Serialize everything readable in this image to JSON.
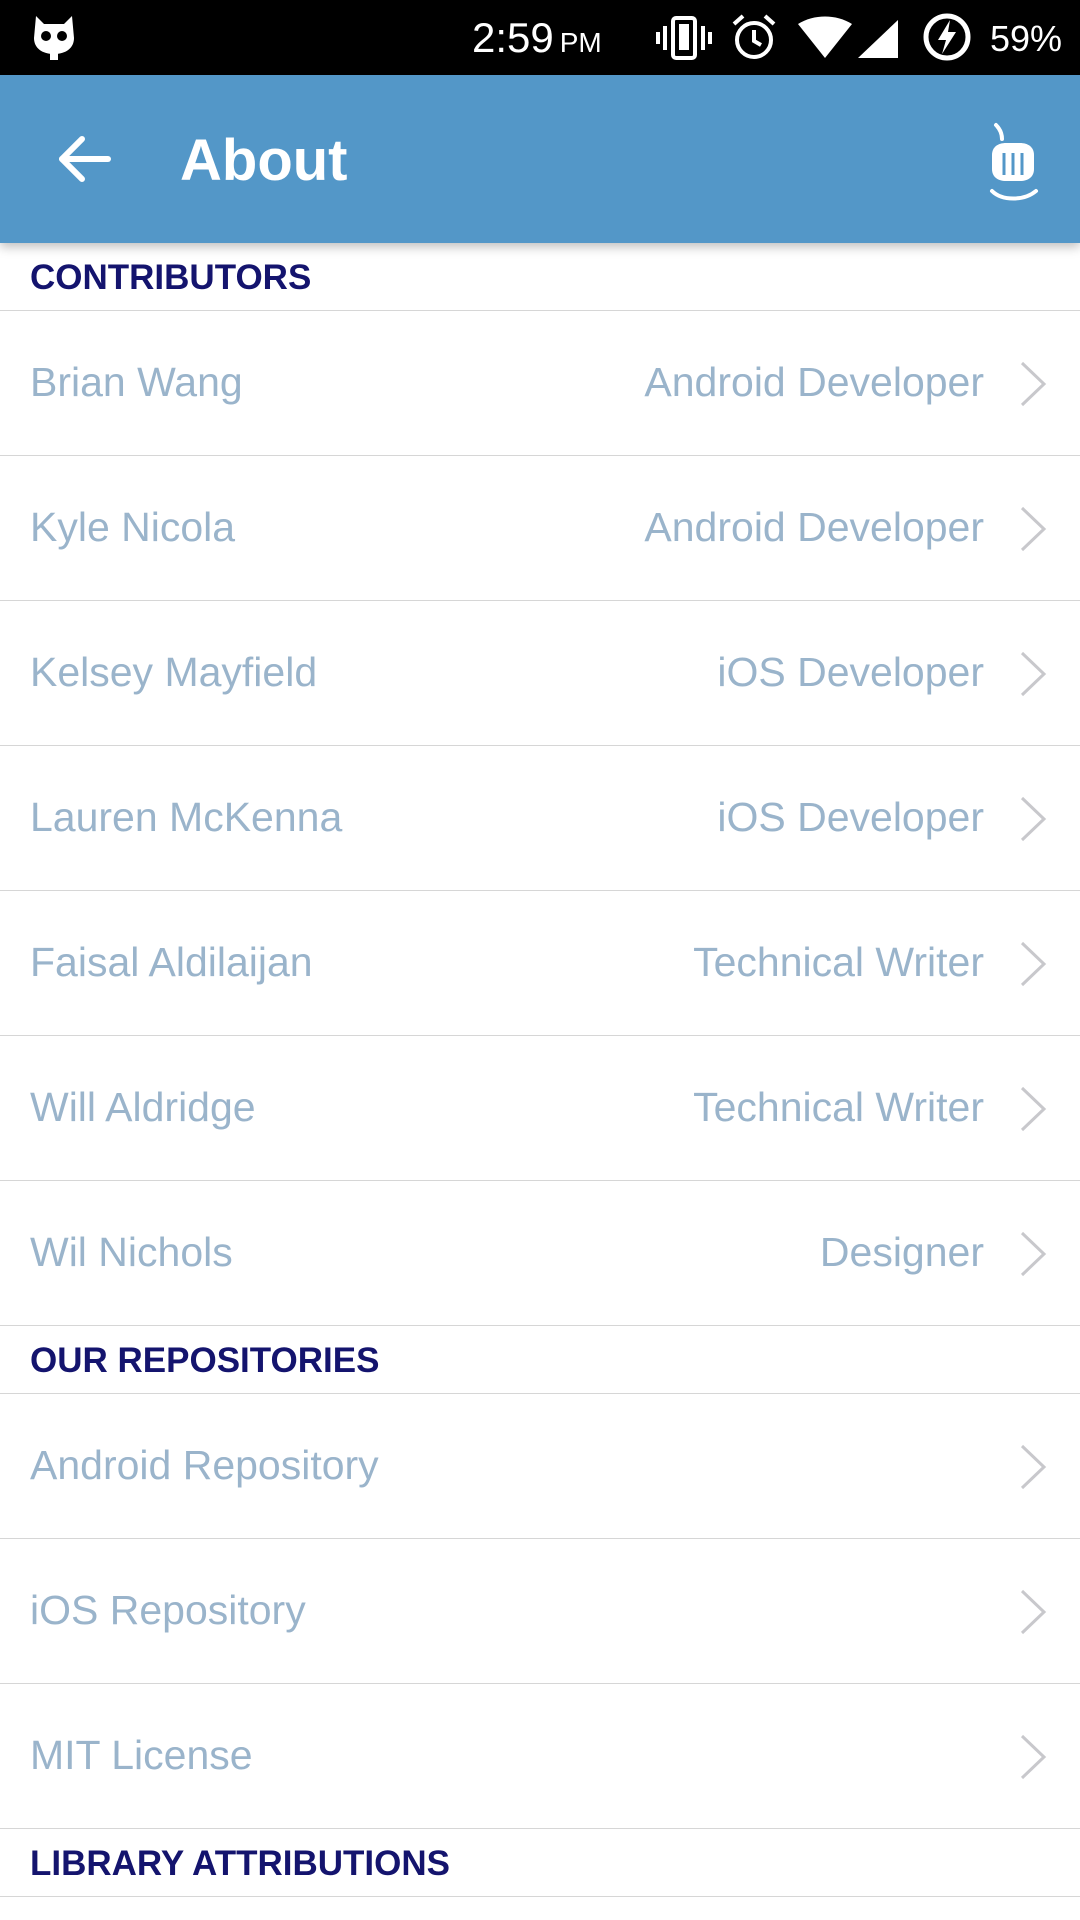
{
  "status_bar": {
    "time": "2:59",
    "ampm": "PM",
    "battery": "59%",
    "icons": [
      "notification-cat-icon",
      "vibrate-icon",
      "alarm-icon",
      "wifi-icon",
      "cell-signal-icon",
      "battery-charging-icon"
    ]
  },
  "app_bar": {
    "title": "About",
    "background": "#5397c8",
    "back_icon": "arrow-back-icon",
    "action_icon": "hand-tap-icon"
  },
  "sections": {
    "contributors": {
      "header": "CONTRIBUTORS",
      "items": [
        {
          "name": "Brian Wang",
          "role": "Android Developer"
        },
        {
          "name": "Kyle Nicola",
          "role": "Android Developer"
        },
        {
          "name": "Kelsey Mayfield",
          "role": "iOS Developer"
        },
        {
          "name": "Lauren McKenna",
          "role": "iOS Developer"
        },
        {
          "name": "Faisal Aldilaijan",
          "role": "Technical Writer"
        },
        {
          "name": "Will Aldridge",
          "role": "Technical Writer"
        },
        {
          "name": "Wil Nichols",
          "role": "Designer"
        }
      ]
    },
    "repositories": {
      "header": "OUR REPOSITORIES",
      "items": [
        {
          "name": "Android Repository"
        },
        {
          "name": "iOS Repository"
        },
        {
          "name": "MIT License"
        }
      ]
    },
    "attributions": {
      "header": "LIBRARY ATTRIBUTIONS"
    }
  },
  "colors": {
    "header_text": "#14146e",
    "row_text": "#9ab4cb",
    "divider": "#d6d6d6"
  }
}
